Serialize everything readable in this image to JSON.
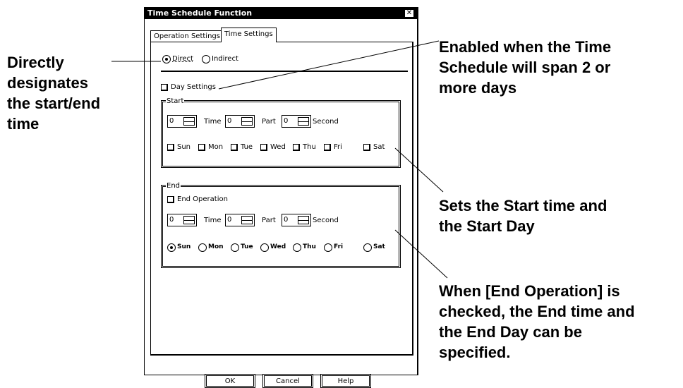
{
  "dialog": {
    "title": "Time Schedule Function",
    "close_icon": "close-icon",
    "tabs": [
      {
        "label": "Operation Settings",
        "active": false
      },
      {
        "label": "Time Settings",
        "active": true
      }
    ],
    "designation": {
      "direct_label": "Direct",
      "indirect_label": "Indirect",
      "selected": "Direct"
    },
    "day_settings_label": "Day Settings",
    "start": {
      "legend": "Start",
      "day_field": "0",
      "time_label": "Time",
      "time_field": "0",
      "part_label": "Part",
      "part_field": "0",
      "second_label": "Second",
      "days": [
        "Sun",
        "Mon",
        "Tue",
        "Wed",
        "Thu",
        "Fri",
        "Sat"
      ]
    },
    "end": {
      "legend": "End",
      "end_operation_label": "End Operation",
      "day_field": "0",
      "time_label": "Time",
      "time_field": "0",
      "part_label": "Part",
      "part_field": "0",
      "second_label": "Second",
      "days": [
        "Sun",
        "Mon",
        "Tue",
        "Wed",
        "Thu",
        "Fri",
        "Sat"
      ],
      "selected_day": "Sun"
    },
    "buttons": {
      "ok": "OK",
      "cancel": "Cancel",
      "help": "Help"
    }
  },
  "callouts": {
    "direct": [
      "Directly",
      "designates",
      "the start/end",
      "time"
    ],
    "day_settings": [
      "Enabled when the Time",
      "Schedule will span 2 or",
      "more days"
    ],
    "start": [
      "Sets the Start time and",
      "the Start Day"
    ],
    "end": [
      "When [End Operation] is",
      "checked, the End time and",
      "the End Day can be",
      "specified."
    ]
  }
}
